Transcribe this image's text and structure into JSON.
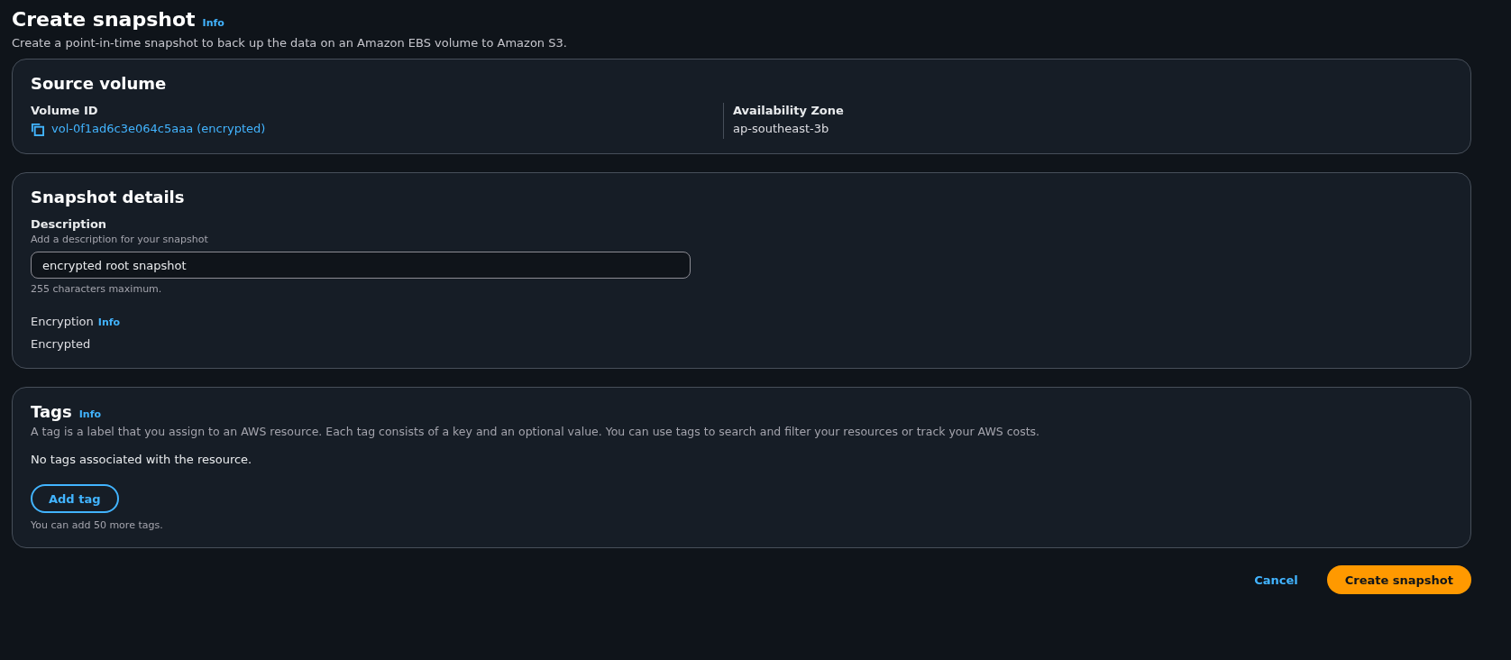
{
  "header": {
    "title": "Create snapshot",
    "info": "Info",
    "description": "Create a point-in-time snapshot to back up the data on an Amazon EBS volume to Amazon S3."
  },
  "source_volume": {
    "heading": "Source volume",
    "fields": [
      {
        "kind": "link",
        "label": "Volume ID",
        "value": "vol-0f1ad6c3e064c5aaa (encrypted)"
      },
      {
        "kind": "text",
        "label": "Availability Zone",
        "value": "ap-southeast-3b"
      }
    ]
  },
  "snapshot_details": {
    "heading": "Snapshot details",
    "description_field": {
      "label": "Description",
      "hint": "Add a description for your snapshot",
      "value": "encrypted root snapshot",
      "constraint": "255 characters maximum."
    },
    "encryption": {
      "label": "Encryption",
      "info": "Info",
      "value": "Encrypted"
    }
  },
  "tags": {
    "heading": "Tags",
    "info": "Info",
    "description": "A tag is a label that you assign to an AWS resource. Each tag consists of a key and an optional value. You can use tags to search and filter your resources or track your AWS costs.",
    "empty": "No tags associated with the resource.",
    "add_button": "Add tag",
    "limit": "You can add 50 more tags."
  },
  "actions": [
    {
      "kind": "link",
      "label": "Cancel"
    },
    {
      "kind": "primary",
      "label": "Create snapshot"
    }
  ]
}
